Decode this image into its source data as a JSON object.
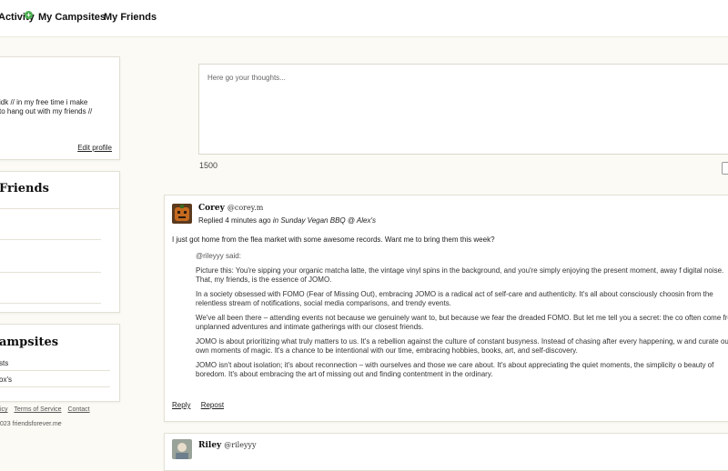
{
  "nav": {
    "items": [
      {
        "label": "Activity"
      },
      {
        "label": "My Campsites"
      },
      {
        "label": "My Friends"
      }
    ],
    "activity_badge": "+"
  },
  "profile": {
    "bio_lines": [
      "idk // in my free time i make",
      "to hang out with my friends //"
    ],
    "edit_label": "Edit profile"
  },
  "friends": {
    "title": "Friends"
  },
  "campsites": {
    "title": "ampsites",
    "items": [
      "sts",
      "ox's"
    ]
  },
  "footer": {
    "links": [
      "icy",
      "Terms of Service",
      "Contact"
    ],
    "copyright": "023 friendsforever.me"
  },
  "composer": {
    "placeholder": "Here go your thoughts...",
    "char_count": "1500"
  },
  "posts": [
    {
      "name": "Corey",
      "handle": "@corey.m",
      "meta_prefix": "Replied 4 minutes ago",
      "meta_in": "in",
      "meta_place": "Sunday Vegan BBQ @ Alex's",
      "body": "I just got home from the flea market with some awesome records. Want me to bring them this week?",
      "quote_by": "@rileyyy said:",
      "quote_paragraphs": [
        "Picture this: You're sipping your organic matcha latte, the vintage vinyl spins in the background, and you're simply enjoying the present moment, away f digital noise. That, my friends, is the essence of JOMO.",
        "In a society obsessed with FOMO (Fear of Missing Out), embracing JOMO is a radical act of self-care and authenticity. It's all about consciously choosin from the relentless stream of notifications, social media comparisons, and trendy events.",
        "We've all been there – attending events not because we genuinely want to, but because we fear the dreaded FOMO. But let me tell you a secret: the co often come from unplanned adventures and intimate gatherings with our closest friends.",
        "JOMO is about prioritizing what truly matters to us. It's a rebellion against the culture of constant busyness. Instead of chasing after every happening, w and curate our own moments of magic. It's a chance to be intentional with our time, embracing hobbies, books, art, and self-discovery.",
        "JOMO isn't about isolation; it's about reconnection – with ourselves and those we care about. It's about appreciating the quiet moments, the simplicity o beauty of boredom. It's about embracing the art of missing out and finding contentment in the ordinary."
      ],
      "actions": [
        "Reply",
        "Repost"
      ]
    },
    {
      "name": "Riley",
      "handle": "@rileyyy"
    }
  ],
  "colors": {
    "background": "#fbfaf4",
    "badge": "#4caf50"
  }
}
